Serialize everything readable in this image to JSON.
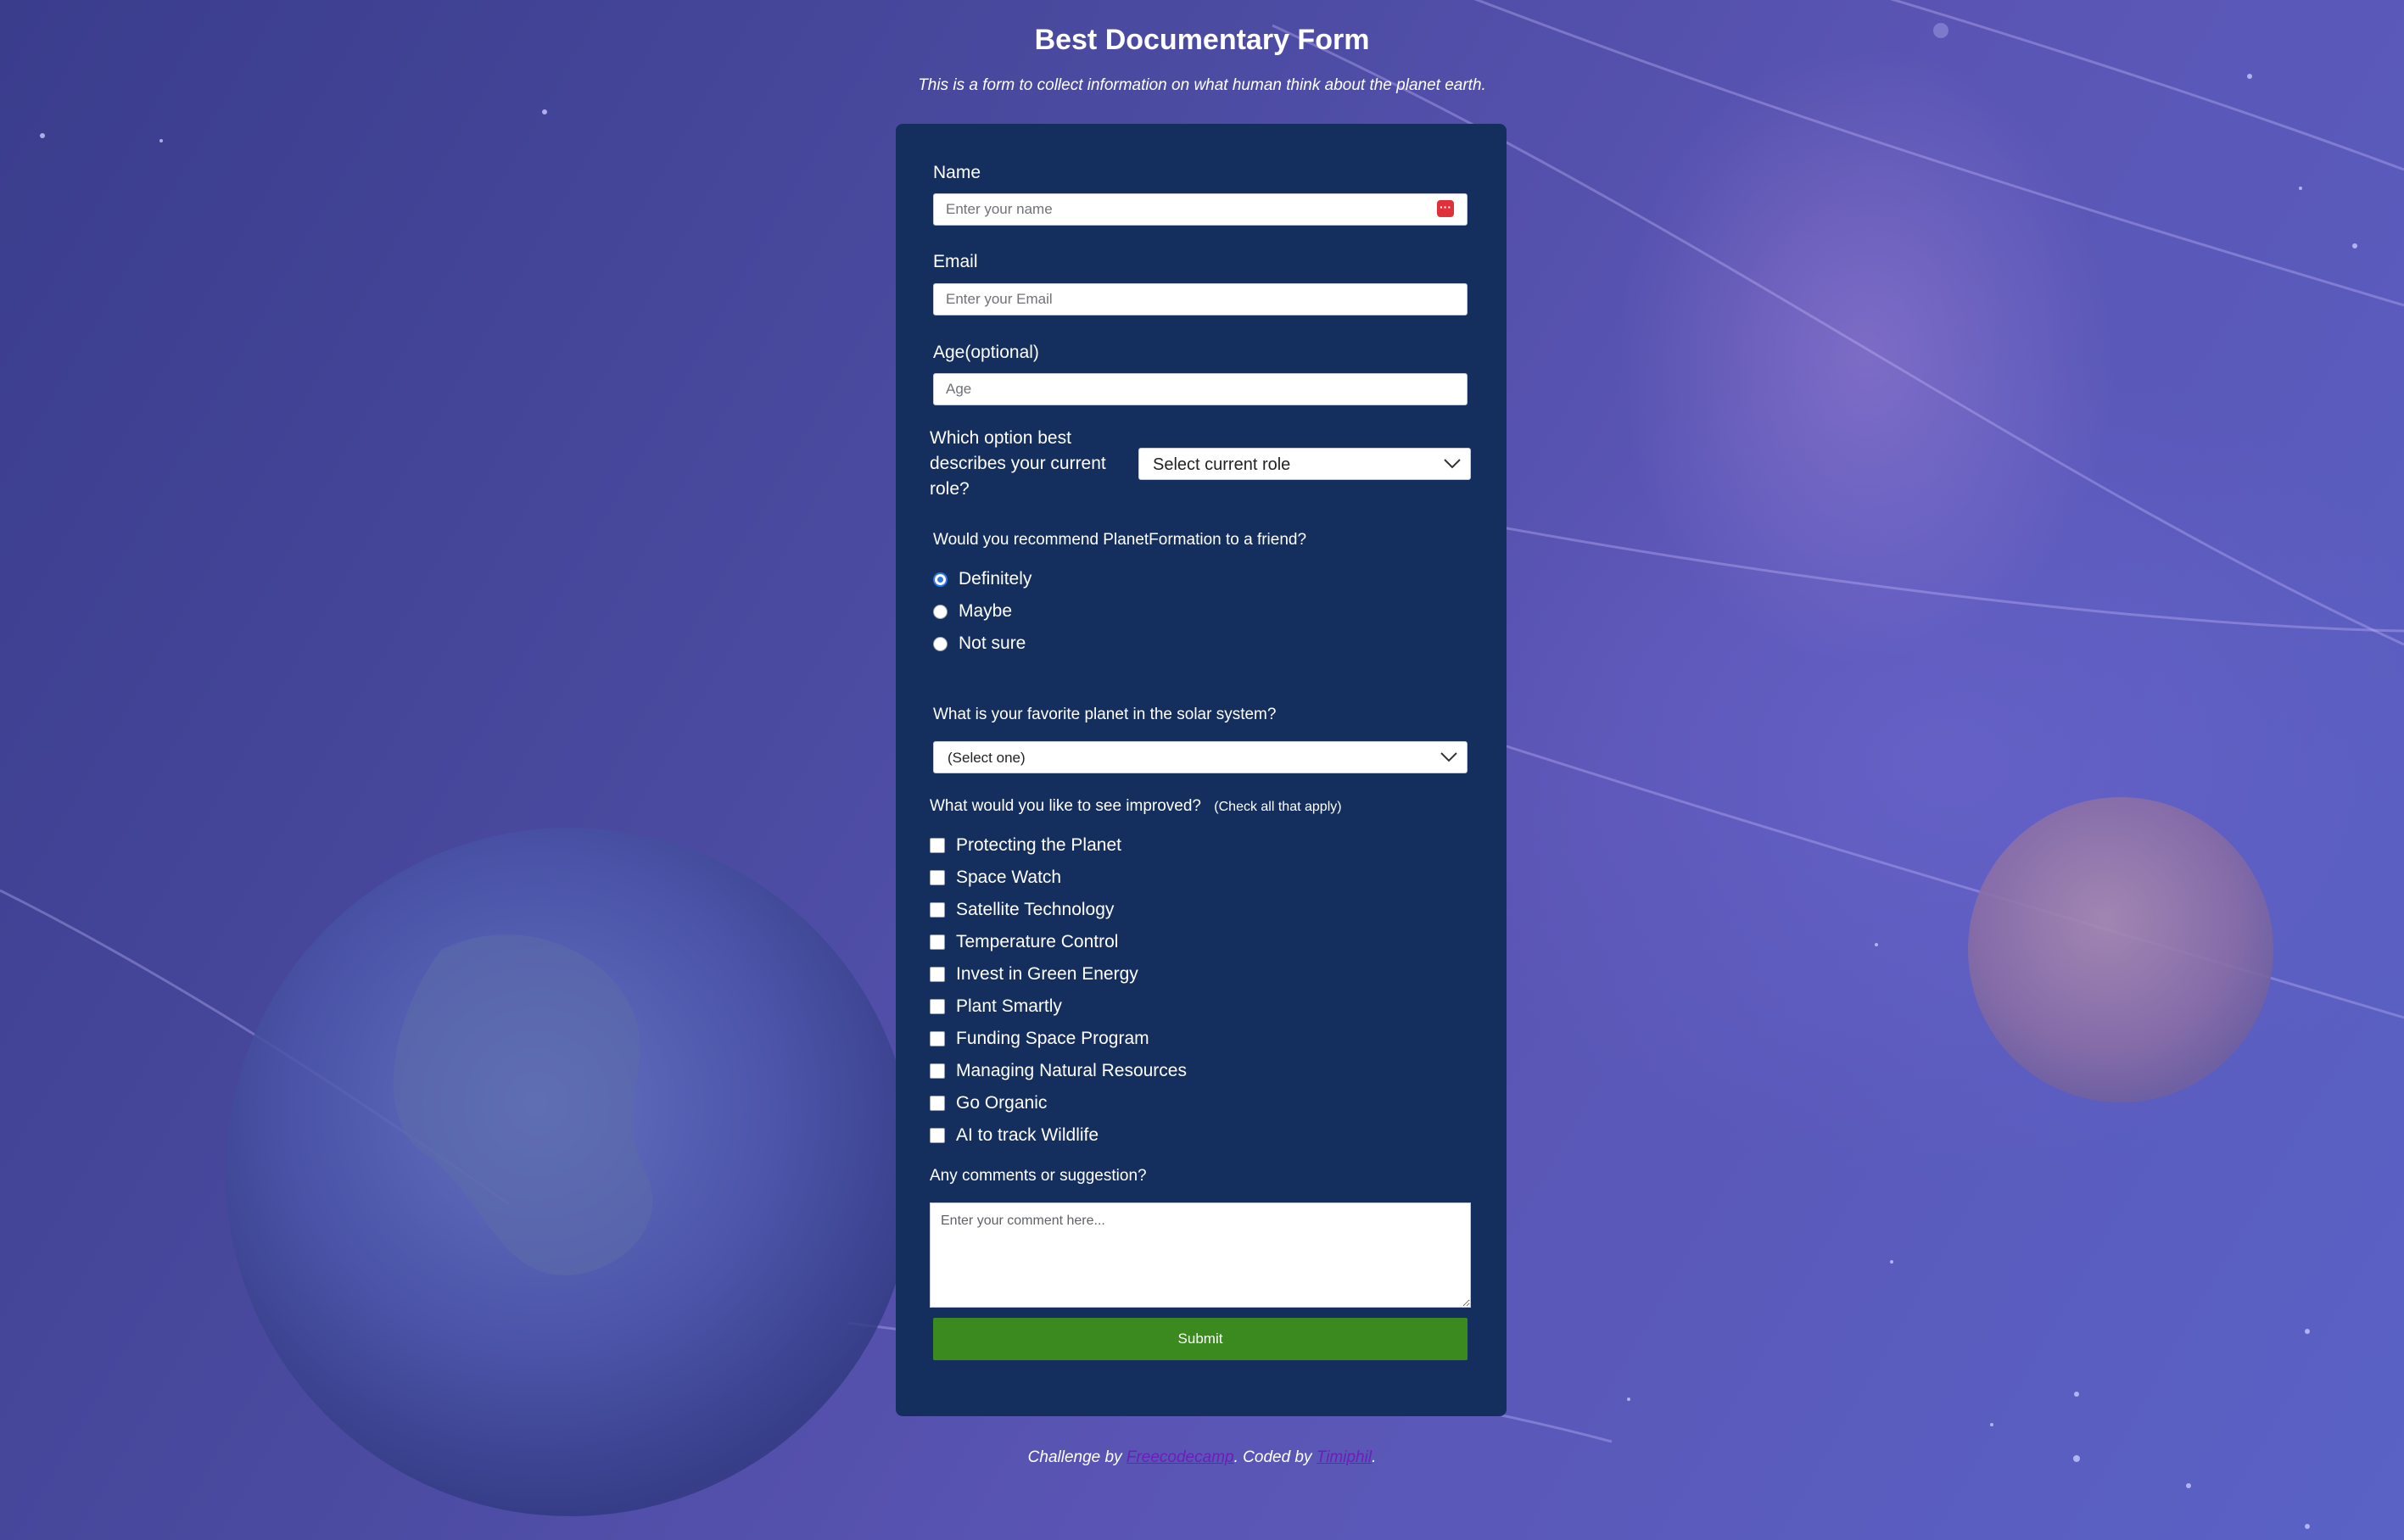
{
  "page": {
    "title": "Best Documentary Form",
    "subtitle": "This is a form to collect information on what human think about the planet earth."
  },
  "form": {
    "name": {
      "label": "Name",
      "placeholder": "Enter your name",
      "icon": "password-manager-icon"
    },
    "email": {
      "label": "Email",
      "placeholder": "Enter your Email"
    },
    "age": {
      "label": "Age(optional)",
      "placeholder": "Age"
    },
    "role": {
      "label_lines": [
        "Which option best",
        "describes your current",
        "role?"
      ],
      "selected": "Select current role"
    },
    "recommend": {
      "question": "Would you recommend PlanetFormation to a friend?",
      "options": [
        {
          "label": "Definitely",
          "checked": true
        },
        {
          "label": "Maybe",
          "checked": false
        },
        {
          "label": "Not sure",
          "checked": false
        }
      ]
    },
    "planet": {
      "question": "What is your favorite planet in the solar system?",
      "selected": "(Select one)"
    },
    "improve": {
      "question": "What would you like to see improved?",
      "hint": "(Check all that apply)",
      "options": [
        "Protecting the Planet",
        "Space Watch",
        "Satellite Technology",
        "Temperature Control",
        "Invest in Green Energy",
        "Plant Smartly",
        "Funding Space Program",
        "Managing Natural Resources",
        "Go Organic",
        "AI to track Wildlife"
      ]
    },
    "comments": {
      "label": "Any comments or suggestion?",
      "placeholder": "Enter your comment here..."
    },
    "submit_label": "Submit"
  },
  "footer": {
    "prefix": "Challenge by ",
    "link1": "Freecodecamp",
    "middle": ". Coded by ",
    "link2": "Timiphil",
    "suffix": "."
  },
  "colors": {
    "card": "#142f5e",
    "submit": "#3b8a1f",
    "radio_accent": "#2f76e8",
    "link": "#6a1fb8"
  }
}
